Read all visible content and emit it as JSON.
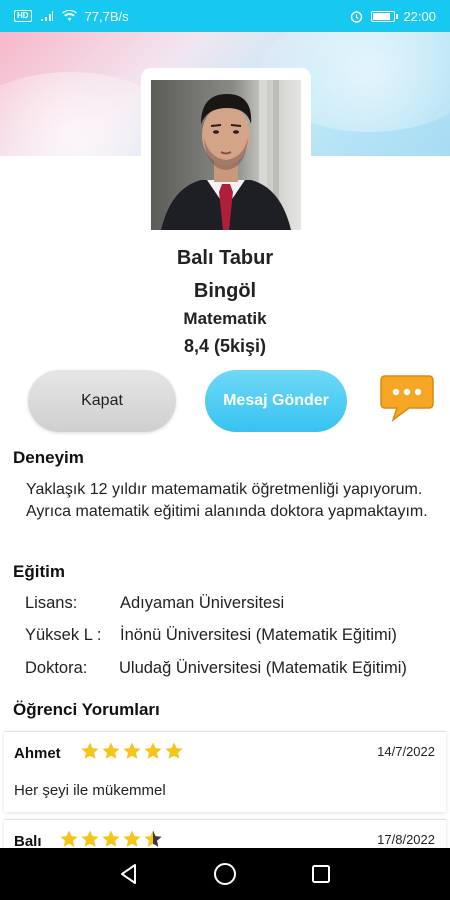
{
  "status_bar": {
    "left_badge": "HD",
    "network_speed": "77,7B/s",
    "time": "22:00",
    "battery_percent": 85
  },
  "profile": {
    "name": "Balı Tabur",
    "city": "Bingöl",
    "subject": "Matematik",
    "rating": "8,4 (5kişi)"
  },
  "actions": {
    "close_label": "Kapat",
    "message_label": "Mesaj Gönder",
    "chat_icon": "chat-bubble-icon"
  },
  "experience": {
    "title": "Deneyim",
    "text": "Yaklaşık 12 yıldır  matemamatik öğretmenliği yapıyorum. Ayrıca matematik eğitimi alanında doktora yapmaktayım."
  },
  "education": {
    "title": "Eğitim",
    "rows": [
      {
        "label": "Lisans:",
        "value": "Adıyaman Üniversitesi"
      },
      {
        "label": "Yüksek L :",
        "value": "İnönü Üniversitesi (Matematik Eğitimi)"
      },
      {
        "label": "Doktora:",
        "value": "Uludağ Üniversitesi (Matematik Eğitimi)"
      }
    ]
  },
  "comments": {
    "title": "Öğrenci Yorumları",
    "items": [
      {
        "author": "Ahmet",
        "stars": 5,
        "date": "14/7/2022",
        "text": "Her şeyi ile mükemmel"
      },
      {
        "author": "Balı",
        "stars": 4.5,
        "date": "17/8/2022",
        "text": ""
      }
    ]
  },
  "colors": {
    "status_bar": "#17c9f0",
    "accent": "#36c3f0",
    "star": "#f5c518",
    "chat_icon": "#f6a623"
  }
}
